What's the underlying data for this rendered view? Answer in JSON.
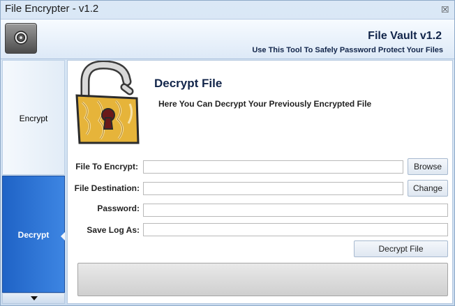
{
  "window": {
    "title": "File Encrypter - v1.2",
    "close_glyph": "⮽"
  },
  "header": {
    "app_icon": "lock-dial-icon",
    "title": "File Vault v1.2",
    "subtitle": "Use This Tool To Safely Password Protect Your Files"
  },
  "sidebar": {
    "items": [
      {
        "label": "Encrypt",
        "active": false
      },
      {
        "label": "Decrypt",
        "active": true
      }
    ],
    "scroll_icon": "chevron-down-icon"
  },
  "main": {
    "illustration": "padlock-icon",
    "title": "Decrypt File",
    "description": "Here You Can Decrypt Your Previously Encrypted File",
    "form": {
      "file_to_encrypt_label": "File To Encrypt:",
      "file_to_encrypt_value": "",
      "file_destination_label": "File Destination:",
      "file_destination_value": "",
      "password_label": "Password:",
      "password_value": "",
      "save_log_label": "Save Log As:",
      "save_log_value": ""
    },
    "buttons": {
      "browse": "Browse",
      "change": "Change",
      "decrypt": "Decrypt File"
    }
  },
  "colors": {
    "active_nav": "#2f74d6",
    "heading": "#12254a",
    "window_bg": "#cfe0f2"
  }
}
